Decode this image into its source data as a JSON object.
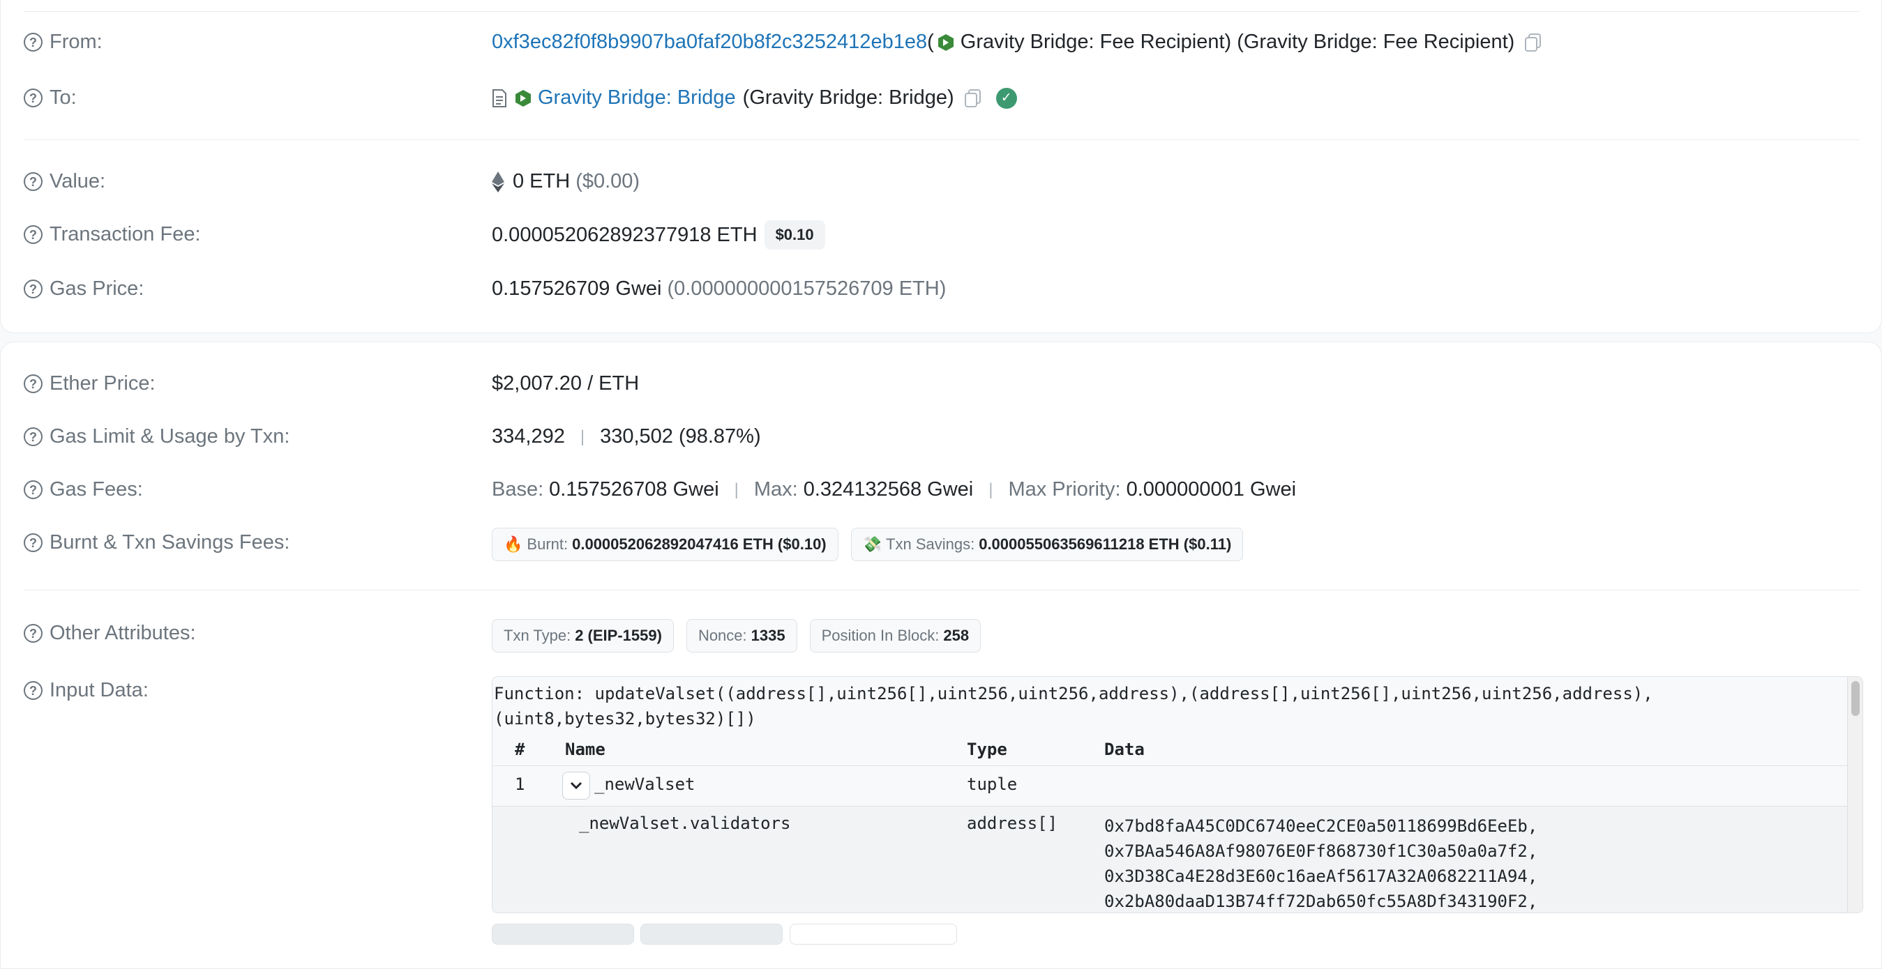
{
  "from": {
    "label": "From:",
    "address": "0xf3ec82f0f8b9907ba0faf20b8f2c3252412eb1e8",
    "open_paren": "(",
    "tag": "Gravity Bridge: Fee Recipient)",
    "tag_repeat": "(Gravity Bridge: Fee Recipient)"
  },
  "to": {
    "label": "To:",
    "name": "Gravity Bridge: Bridge",
    "tag": "(Gravity Bridge: Bridge)"
  },
  "value": {
    "label": "Value:",
    "amount": "0 ETH",
    "usd": "($0.00)"
  },
  "txn_fee": {
    "label": "Transaction Fee:",
    "amount": "0.000052062892377918 ETH",
    "usd_badge": "$0.10"
  },
  "gas_price": {
    "label": "Gas Price:",
    "gwei": "0.157526709 Gwei",
    "eth": "(0.000000000157526709 ETH)"
  },
  "ether_price": {
    "label": "Ether Price:",
    "value": "$2,007.20 / ETH"
  },
  "gas_limit": {
    "label": "Gas Limit & Usage by Txn:",
    "limit": "334,292",
    "separator": "|",
    "usage": "330,502 (98.87%)"
  },
  "gas_fees": {
    "label": "Gas Fees:",
    "base_label": "Base:",
    "base_value": "0.157526708 Gwei",
    "max_label": "Max:",
    "max_value": "0.324132568 Gwei",
    "priority_label": "Max Priority:",
    "priority_value": "0.000000001 Gwei"
  },
  "burnt": {
    "label": "Burnt & Txn Savings Fees:",
    "burnt_icon": "🔥",
    "burnt_label": "Burnt:",
    "burnt_value": "0.000052062892047416 ETH ($0.10)",
    "savings_icon": "💸",
    "savings_label": "Txn Savings:",
    "savings_value": "0.000055063569611218 ETH ($0.11)"
  },
  "other": {
    "label": "Other Attributes:",
    "txn_type_label": "Txn Type:",
    "txn_type_value": "2 (EIP-1559)",
    "nonce_label": "Nonce:",
    "nonce_value": "1335",
    "position_label": "Position In Block:",
    "position_value": "258"
  },
  "input_data": {
    "label": "Input Data:",
    "function_sig": "Function: updateValset((address[],uint256[],uint256,uint256,address),(address[],uint256[],uint256,uint256,address),\n(uint8,bytes32,bytes32)[])",
    "columns": [
      "#",
      "Name",
      "Type",
      "Data"
    ],
    "row1": {
      "index": "1",
      "name": "_newValset",
      "type": "tuple",
      "data": ""
    },
    "row2": {
      "name": "_newValset.validators",
      "type": "address[]",
      "data": [
        "0x7bd8faA45C0DC6740eeC2CE0a50118699Bd6EeEb,",
        "0x7BAa546A8Af98076E0Ff868730f1C30a50a0a7f2,",
        "0x3D38Ca4E28d3E60c16aeAf5617A32A0682211A94,",
        "0x2bA80daaD13B74ff72Dab650fc55A8Df343190F2,"
      ]
    }
  },
  "colors": {
    "link": "#1e74b7",
    "muted": "#6c757d",
    "success": "#3d9970",
    "bridge_green": "#3a8a3a"
  }
}
